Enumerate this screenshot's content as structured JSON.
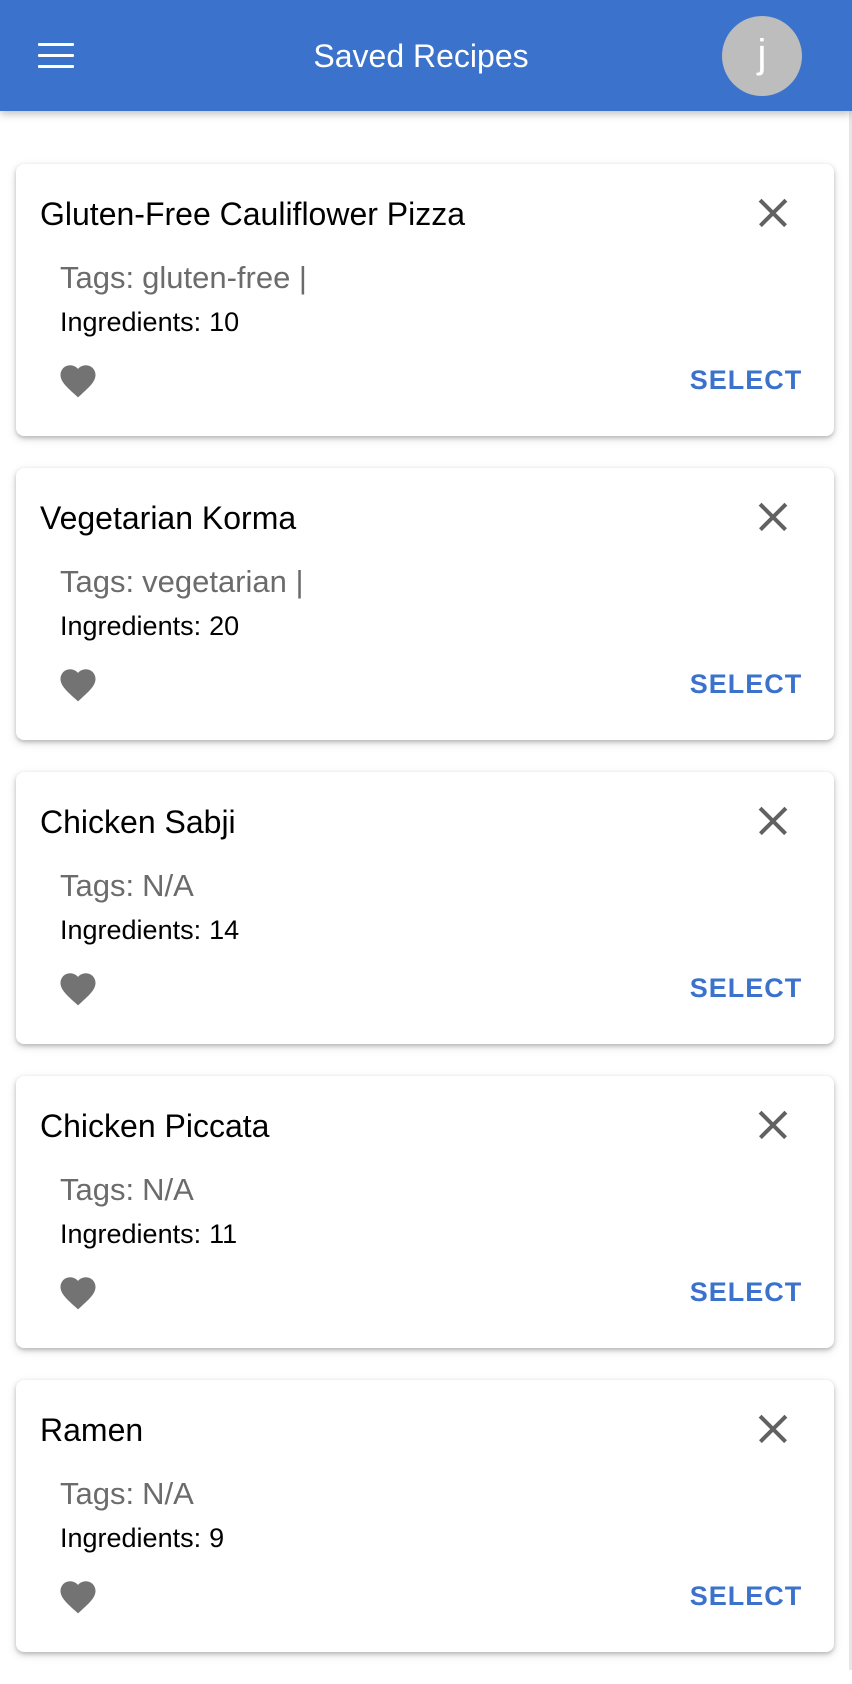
{
  "header": {
    "title": "Saved Recipes",
    "menu_icon": "menu-icon",
    "avatar_initial": "j"
  },
  "labels": {
    "tags_prefix": "Tags:",
    "ingredients_prefix": "Ingredients:",
    "select": "SELECT"
  },
  "colors": {
    "app_bar": "#3b73cc",
    "accent": "#3b73cc",
    "avatar": "#bdbdbd",
    "icon": "#616161"
  },
  "recipes": [
    {
      "name": "Gluten-Free Cauliflower Pizza",
      "tags": "gluten-free |",
      "ingredients": "10"
    },
    {
      "name": "Vegetarian Korma",
      "tags": "vegetarian |",
      "ingredients": "20"
    },
    {
      "name": "Chicken Sabji",
      "tags": "N/A",
      "ingredients": "14"
    },
    {
      "name": "Chicken Piccata",
      "tags": "N/A",
      "ingredients": "11"
    },
    {
      "name": "Ramen",
      "tags": "N/A",
      "ingredients": "9"
    }
  ]
}
